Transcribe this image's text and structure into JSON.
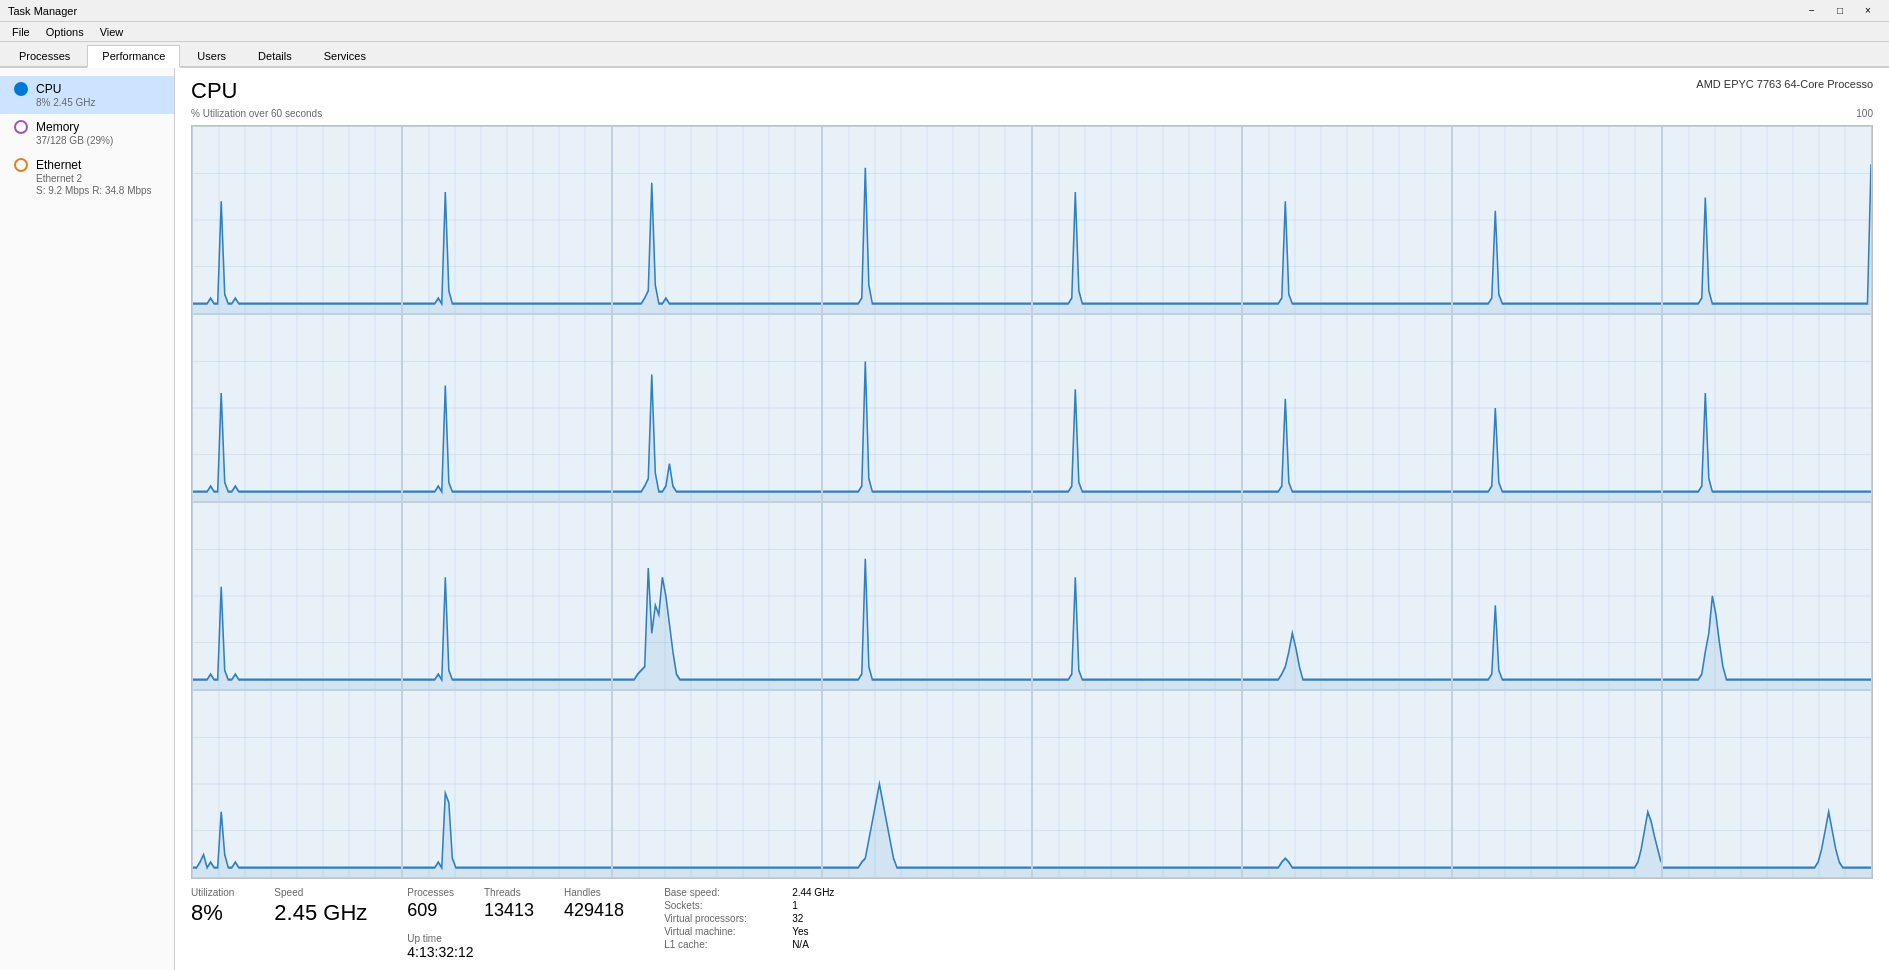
{
  "titleBar": {
    "title": "Task Manager",
    "minimizeLabel": "−",
    "maximizeLabel": "□",
    "closeLabel": "×"
  },
  "menuBar": {
    "items": [
      "File",
      "Options",
      "View"
    ]
  },
  "tabs": [
    {
      "label": "Processes",
      "active": false
    },
    {
      "label": "Performance",
      "active": true
    },
    {
      "label": "Users",
      "active": false
    },
    {
      "label": "Details",
      "active": false
    },
    {
      "label": "Services",
      "active": false
    }
  ],
  "sidebar": {
    "items": [
      {
        "name": "CPU",
        "sub1": "8% 2.45 GHz",
        "sub2": null,
        "iconType": "cpu",
        "active": true
      },
      {
        "name": "Memory",
        "sub1": "37/128 GB (29%)",
        "sub2": null,
        "iconType": "memory",
        "active": false
      },
      {
        "name": "Ethernet",
        "sub1": "Ethernet 2",
        "sub2": "S: 9.2 Mbps  R: 34.8 Mbps",
        "iconType": "ethernet",
        "active": false
      }
    ]
  },
  "content": {
    "title": "CPU",
    "cpuModel": "AMD EPYC 7763 64-Core Processo",
    "utilizationLabel": "% Utilization over 60 seconds",
    "maxLabel": "100",
    "stats": {
      "utilizationLabel": "Utilization",
      "utilizationValue": "8%",
      "speedLabel": "Speed",
      "speedValue": "2.45 GHz",
      "processesLabel": "Processes",
      "processesValue": "609",
      "threadsLabel": "Threads",
      "threadsValue": "13413",
      "handlesLabel": "Handles",
      "handlesValue": "429418",
      "uptimeLabel": "Up time",
      "uptimeValue": "4:13:32:12"
    },
    "details": {
      "baseSpeedLabel": "Base speed:",
      "baseSpeedValue": "2.44 GHz",
      "socketsLabel": "Sockets:",
      "socketsValue": "1",
      "virtualProcessorsLabel": "Virtual processors:",
      "virtualProcessorsValue": "32",
      "virtualMachineLabel": "Virtual machine:",
      "virtualMachineValue": "Yes",
      "l1CacheLabel": "L1 cache:",
      "l1CacheValue": "N/A"
    }
  }
}
